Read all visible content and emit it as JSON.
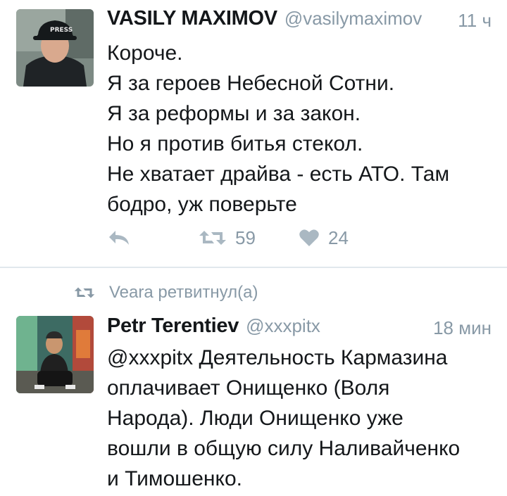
{
  "tweets": [
    {
      "display_name": "VASILY MAXIMOV",
      "handle": "@vasilymaximov",
      "time": "11 ч",
      "text_lines": [
        "Короче.",
        "Я за героев Небесной Сотни.",
        "Я за реформы и за закон.",
        "Но я против битья стекол.",
        "Не хватает драйва - есть АТО. Там",
        "бодро, уж поверьте"
      ],
      "retweet_count": "59",
      "like_count": "24",
      "avatar_cap_text": "PRESS"
    },
    {
      "retweeted_by": "Veara ретвитнул(а)",
      "display_name": "Petr Terentiev",
      "handle": "@xxxpitx",
      "time": "18 мин",
      "text_lines": [
        "@xxxpitx Деятельность Кармазина",
        "оплачивает Онищенко (Воля",
        "Народа). Люди Онищенко уже",
        "вошли в общую силу Наливайченко",
        "и Тимошенко."
      ]
    }
  ],
  "colors": {
    "text": "#14171a",
    "secondary": "#8899a6",
    "divider": "#e1e8ed"
  },
  "icons": [
    "reply-icon",
    "retweet-icon",
    "heart-icon"
  ]
}
